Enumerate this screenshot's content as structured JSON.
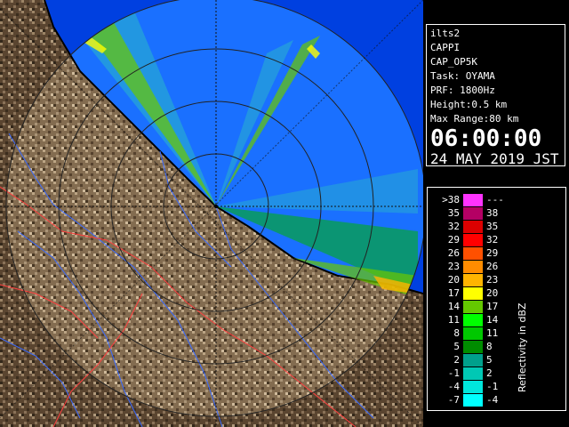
{
  "info": {
    "site": "ilts2",
    "product": "CAPPI",
    "product_code": "CAP_OP5K",
    "task": "Task: OYAMA",
    "prf": "PRF: 1800Hz",
    "height": "Height:0.5 km",
    "max_range": "Max Range:80 km",
    "time": "06:00:00",
    "date": "24 MAY 2019 JST"
  },
  "legend": {
    "title": "Reflectivity in dBZ",
    "rows": [
      {
        "lo": ">38",
        "hi": "---",
        "color": "#ff33ff"
      },
      {
        "lo": "35",
        "hi": "38",
        "color": "#b40064"
      },
      {
        "lo": "32",
        "hi": "35",
        "color": "#dc0000"
      },
      {
        "lo": "29",
        "hi": "32",
        "color": "#ff0000"
      },
      {
        "lo": "26",
        "hi": "29",
        "color": "#ff5000"
      },
      {
        "lo": "23",
        "hi": "26",
        "color": "#ff8c00"
      },
      {
        "lo": "20",
        "hi": "23",
        "color": "#ffb400"
      },
      {
        "lo": "17",
        "hi": "20",
        "color": "#ffff00"
      },
      {
        "lo": "14",
        "hi": "17",
        "color": "#64c800"
      },
      {
        "lo": "11",
        "hi": "14",
        "color": "#00ff00"
      },
      {
        "lo": "8",
        "hi": "11",
        "color": "#00c800"
      },
      {
        "lo": "5",
        "hi": "8",
        "color": "#008c00"
      },
      {
        "lo": "2",
        "hi": "5",
        "color": "#00a08c"
      },
      {
        "lo": "-1",
        "hi": "2",
        "color": "#00c8b4"
      },
      {
        "lo": "-4",
        "hi": "-1",
        "color": "#00e6dc"
      },
      {
        "lo": "-7",
        "hi": "-4",
        "color": "#00ffff"
      }
    ]
  },
  "colors": {
    "sea": "#0044ee",
    "sea_in_range": "#1a7dff",
    "land_dark": "#4a3a26",
    "land_light": "#a89070",
    "coastline": "#000000",
    "rivers": "#3a6aff",
    "boundaries": "#ff4040",
    "range_rings": "#222222"
  }
}
